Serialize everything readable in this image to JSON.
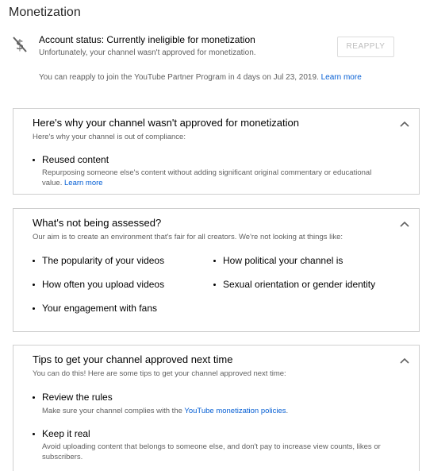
{
  "page": {
    "title": "Monetization"
  },
  "status": {
    "icon": "no-money-icon",
    "title": "Account status: Currently ineligible for monetization",
    "description": "Unfortunately, your channel wasn't approved for monetization.",
    "reapply_label": "REAPPLY",
    "reapply_note": "You can reapply to join the YouTube Partner Program in 4 days on Jul 23, 2019.",
    "learn_more": "Learn more"
  },
  "cards": {
    "why": {
      "title": "Here's why your channel wasn't approved for monetization",
      "subtitle": "Here's why your channel is out of compliance:",
      "reason": {
        "label": "Reused content",
        "description_line1": "Repurposing someone else's content without adding significant original commentary or educational",
        "description_line2": "value.",
        "learn_more": "Learn more"
      }
    },
    "not_assessed": {
      "title": "What's not being assessed?",
      "subtitle": "Our aim is to create an environment that's fair for all creators. We're not looking at things like:",
      "items": [
        "The popularity of your videos",
        "How political your channel is",
        "How often you upload videos",
        "Sexual orientation or gender identity",
        "Your engagement with fans"
      ]
    },
    "tips": {
      "title": "Tips to get your channel approved next time",
      "subtitle": "You can do this! Here are some tips to get your channel approved next time:",
      "tip1": {
        "label": "Review the rules",
        "description_prefix": "Make sure your channel complies with the ",
        "description_link": "YouTube monetization policies",
        "description_suffix": "."
      },
      "tip2": {
        "label": "Keep it real",
        "description_line1": "Avoid uploading content that belongs to someone else, and don't pay to increase view counts, likes or",
        "description_line2": "subscribers."
      }
    }
  },
  "colors": {
    "link": "#065fd4",
    "muted": "#606060",
    "border": "#cfcfcf"
  }
}
